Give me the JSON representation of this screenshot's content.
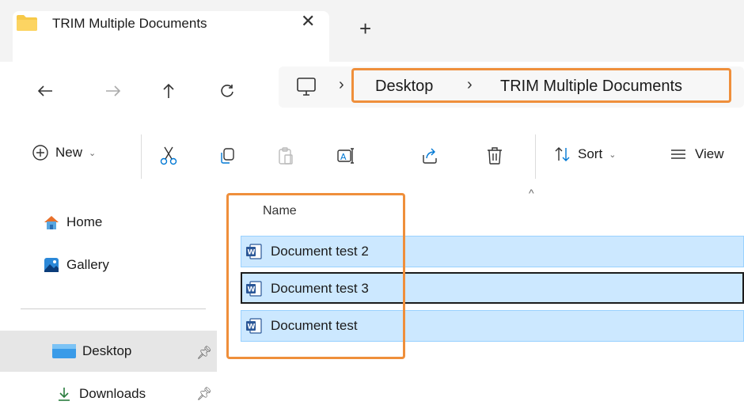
{
  "tab": {
    "title": "TRIM Multiple Documents",
    "close_glyph": "✕",
    "new_tab_glyph": "+"
  },
  "nav": {
    "back": "←",
    "forward": "→",
    "up": "↑",
    "refresh": "↻"
  },
  "address": {
    "separator": "›",
    "crumbs": [
      "Desktop",
      "TRIM Multiple Documents"
    ]
  },
  "toolbar": {
    "new_label": "New",
    "sort_label": "Sort",
    "view_label": "View",
    "caret": "⌄"
  },
  "sidebar": {
    "items": [
      {
        "label": "Home",
        "icon": "home-icon"
      },
      {
        "label": "Gallery",
        "icon": "gallery-icon"
      },
      {
        "label": "Desktop",
        "icon": "desktop-icon",
        "pinned": true,
        "selected": true
      },
      {
        "label": "Downloads",
        "icon": "download-icon",
        "pinned": true
      }
    ]
  },
  "filelist": {
    "column_name": "Name",
    "sort_glyph": "^",
    "rows": [
      {
        "name": "Document test 2",
        "selected": true
      },
      {
        "name": "Document test 3",
        "selected": true,
        "focused": true
      },
      {
        "name": "Document test",
        "selected": true
      }
    ]
  },
  "colors": {
    "highlight": "#ef8f3b",
    "selection": "#cce8ff",
    "selection_border": "#99d1ff",
    "accent": "#0078d4"
  }
}
